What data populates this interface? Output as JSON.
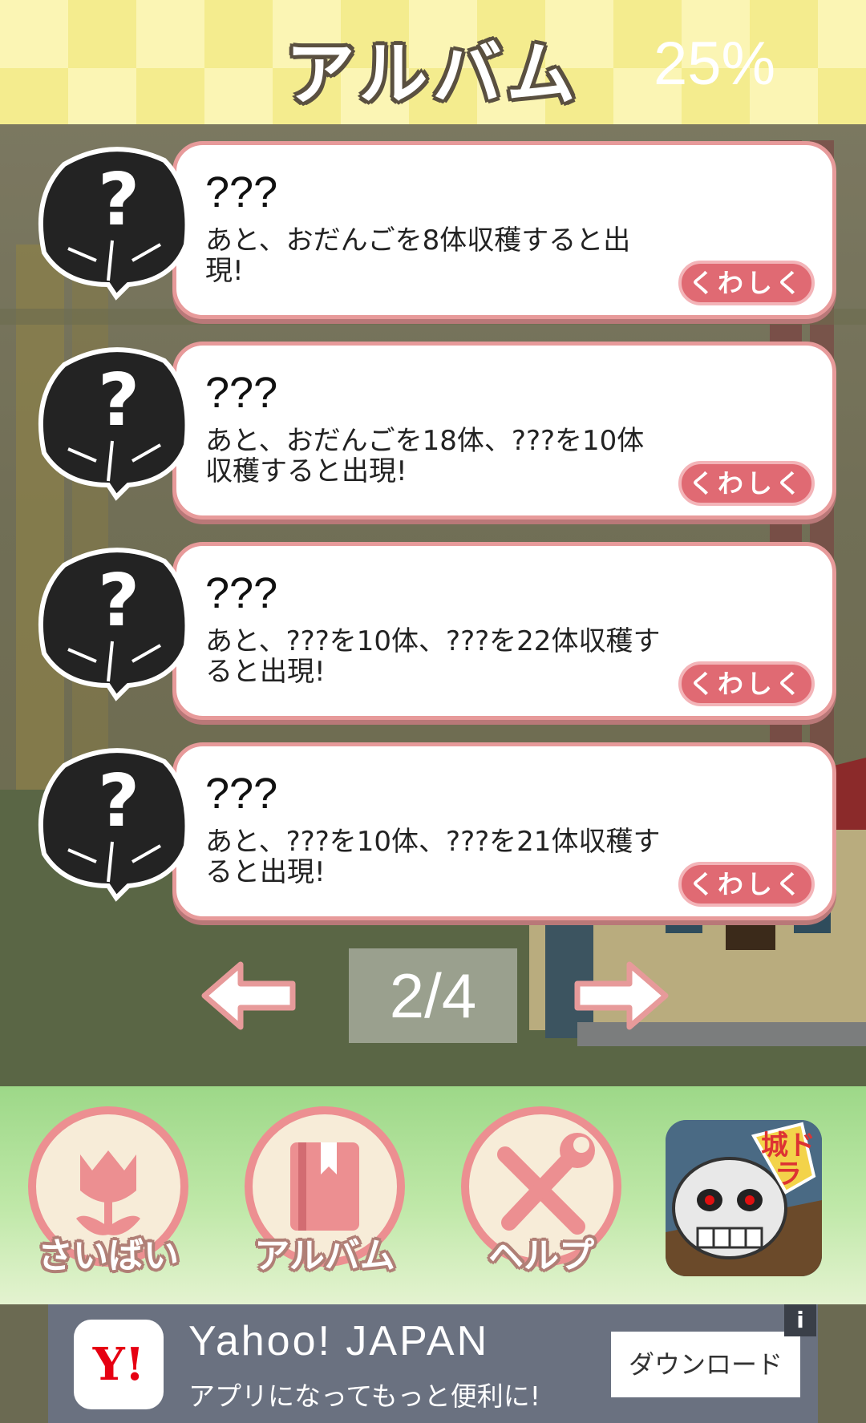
{
  "header": {
    "title": "アルバム",
    "percent": "25%"
  },
  "album": {
    "items": [
      {
        "name": "???",
        "description": "あと、おだんごを8体収穫すると出現!",
        "detail_label": "くわしく",
        "avatar_icon": "silhouette-question-icon"
      },
      {
        "name": "???",
        "description": "あと、おだんごを18体、???を10体収穫すると出現!",
        "detail_label": "くわしく",
        "avatar_icon": "silhouette-question-icon"
      },
      {
        "name": "???",
        "description": "あと、???を10体、???を22体収穫すると出現!",
        "detail_label": "くわしく",
        "avatar_icon": "silhouette-question-icon"
      },
      {
        "name": "???",
        "description": "あと、???を10体、???を21体収穫すると出現!",
        "detail_label": "くわしく",
        "avatar_icon": "silhouette-question-icon"
      }
    ]
  },
  "pager": {
    "label": "2/4",
    "prev_icon": "arrow-left-icon",
    "next_icon": "arrow-right-icon"
  },
  "nav": {
    "items": [
      {
        "label": "さいばい",
        "icon": "tulip-icon"
      },
      {
        "label": "アルバム",
        "icon": "book-icon"
      },
      {
        "label": "ヘルプ",
        "icon": "tools-icon"
      }
    ],
    "promo_icon": "shirodora-app-icon",
    "promo_text": "城ドラ"
  },
  "ad": {
    "logo": "Y!",
    "title": "Yahoo! JAPAN",
    "subtitle": "アプリになってもっと便利に!",
    "button": "ダウンロード",
    "info": "i"
  },
  "colors": {
    "card_border": "#e79a9a",
    "button_pink": "#e06a73",
    "header_yellow": "#fbf5b4",
    "ad_bg": "#6a7180"
  }
}
